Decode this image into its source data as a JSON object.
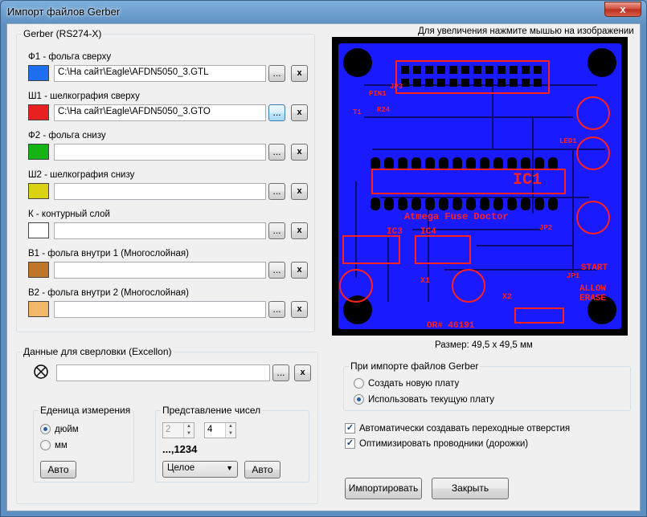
{
  "window": {
    "title": "Импорт файлов Gerber",
    "close_glyph": "x"
  },
  "gerber": {
    "legend": "Gerber (RS274-X)",
    "browse_label": "...",
    "clear_label": "x",
    "layers": [
      {
        "label": "Ф1 - фольга сверху",
        "color": "#1e6ff0",
        "path": "C:\\На сайт\\Eagle\\AFDN5050_3.GTL"
      },
      {
        "label": "Ш1 - шелкография сверху",
        "color": "#e8201f",
        "path": "C:\\На сайт\\Eagle\\AFDN5050_3.GTO"
      },
      {
        "label": "Ф2 - фольга снизу",
        "color": "#14b414",
        "path": ""
      },
      {
        "label": "Ш2 - шелкография снизу",
        "color": "#dcd214",
        "path": ""
      },
      {
        "label": "К - контурный слой",
        "color": "#ffffff",
        "path": ""
      },
      {
        "label": "В1 - фольга внутри 1 (Многослойная)",
        "color": "#c0762a",
        "path": ""
      },
      {
        "label": "В2 - фольга внутри 2 (Многослойная)",
        "color": "#f0b868",
        "path": ""
      }
    ]
  },
  "preview": {
    "hint": "Для увеличения нажмите мышью на изображении",
    "size_text": "Размер: 49,5 x 49,5 мм",
    "labels": {
      "ic1": "IC1",
      "ic3": "IC3",
      "ic4": "IC4",
      "title": "Atmega Fuse Doctor",
      "order": "OR# 46191",
      "start": "START",
      "allow": "ALLOW",
      "erase": "ERASE",
      "pin1": "PIN1",
      "jp3": "JP3",
      "x1": "X1",
      "x2": "X2",
      "jp1": "JP1",
      "jp2": "JP2",
      "led1": "LED1",
      "r24": "R24",
      "t1": "T1"
    },
    "colors": {
      "board": "#1a1aff",
      "silk": "#ff2020",
      "background": "#000000"
    }
  },
  "drill": {
    "legend": "Данные для сверловки (Excellon)",
    "icon": "crosshair-circle-icon",
    "path": "",
    "units": {
      "legend": "Еденица измерения",
      "options": [
        "дюйм",
        "мм"
      ],
      "selected": 0,
      "auto_label": "Авто"
    },
    "format": {
      "legend": "Представление чисел",
      "int_digits": "2",
      "dec_digits": "4",
      "preview": "...,1234",
      "mode": "Целое",
      "auto_label": "Авто"
    }
  },
  "import_mode": {
    "legend": "При импорте файлов Gerber",
    "options": [
      "Создать новую плату",
      "Использовать текущую плату"
    ],
    "selected": 1
  },
  "checks": [
    {
      "label": "Автоматически создавать переходные отверстия",
      "checked": true
    },
    {
      "label": "Оптимизировать проводники (дорожки)",
      "checked": true
    }
  ],
  "actions": {
    "import_label": "Импортировать",
    "close_label": "Закрыть"
  }
}
